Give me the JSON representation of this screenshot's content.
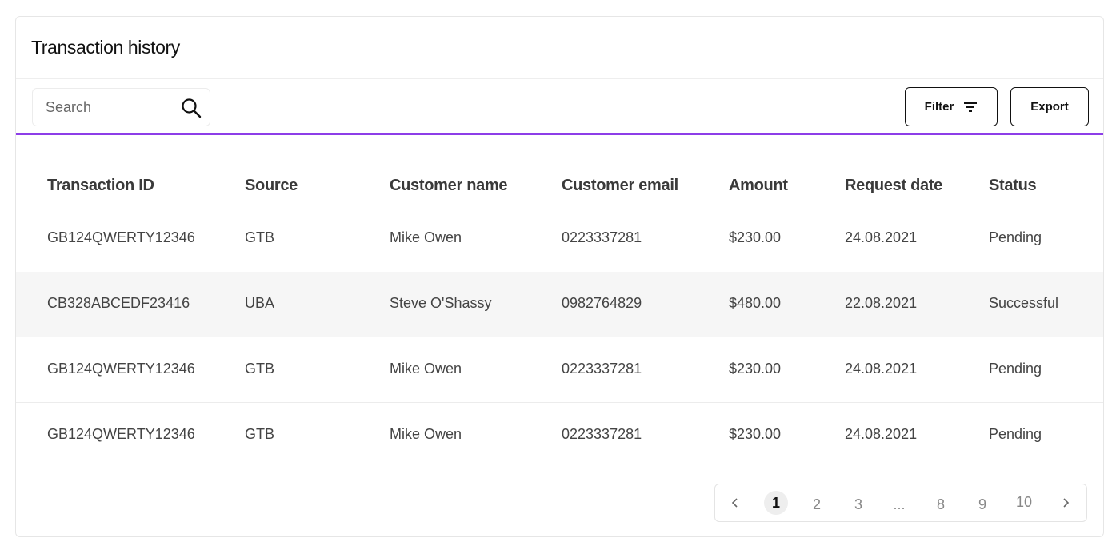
{
  "header": {
    "title": "Transaction history"
  },
  "search": {
    "placeholder": "Search"
  },
  "toolbar": {
    "filter_label": "Filter",
    "export_label": "Export"
  },
  "table": {
    "columns": [
      "Transaction ID",
      "Source",
      "Customer name",
      "Customer email",
      "Amount",
      "Request date",
      "Status"
    ],
    "rows": [
      [
        "GB124QWERTY12346",
        "GTB",
        "Mike Owen",
        "0223337281",
        "$230.00",
        "24.08.2021",
        "Pending"
      ],
      [
        "CB328ABCEDF23416",
        "UBA",
        "Steve O'Shassy",
        "0982764829",
        "$480.00",
        "22.08.2021",
        "Successful"
      ],
      [
        "GB124QWERTY12346",
        "GTB",
        "Mike Owen",
        "0223337281",
        "$230.00",
        "24.08.2021",
        "Pending"
      ],
      [
        "GB124QWERTY12346",
        "GTB",
        "Mike Owen",
        "0223337281",
        "$230.00",
        "24.08.2021",
        "Pending"
      ]
    ]
  },
  "pagination": {
    "pages": [
      "1",
      "2",
      "3",
      "...",
      "8",
      "9",
      "10"
    ],
    "current": "1"
  },
  "colors": {
    "accent": "#8d3ee8",
    "row_highlight": "#f6f6f6"
  },
  "icons": {
    "search": "search-icon",
    "filter": "filter-icon",
    "prev": "chevron-left-icon",
    "next": "chevron-right-icon"
  }
}
